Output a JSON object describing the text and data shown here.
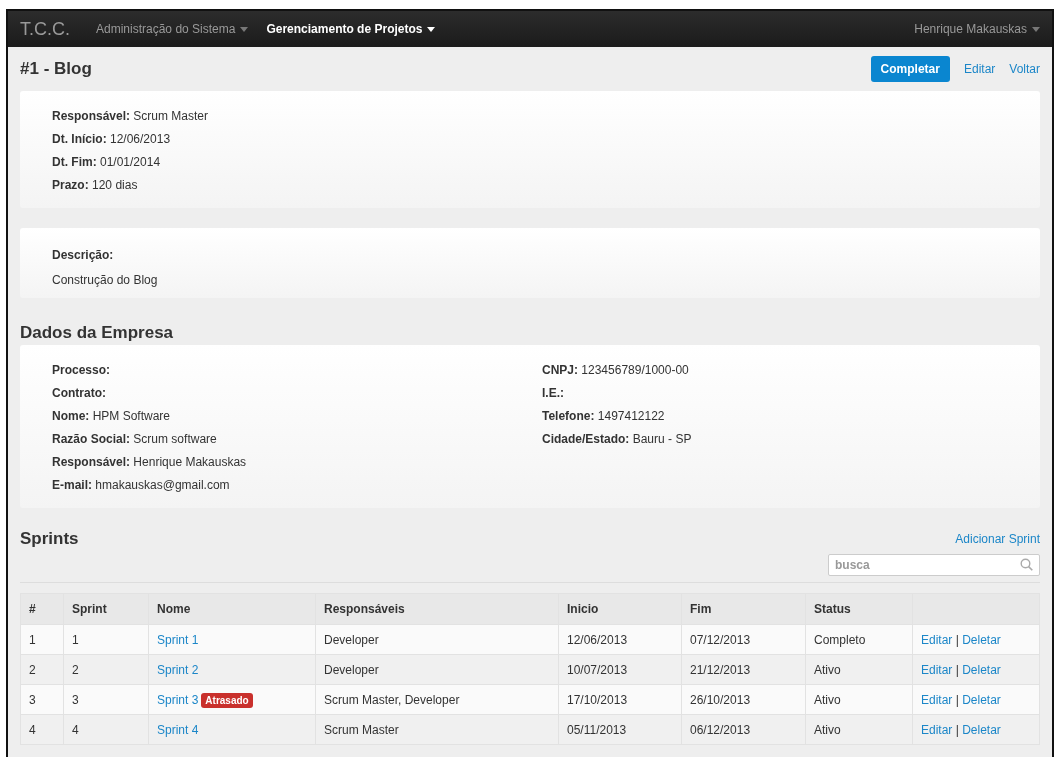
{
  "navbar": {
    "brand": "T.C.C.",
    "menus": [
      {
        "label": "Administração do Sistema",
        "selected": false
      },
      {
        "label": "Gerenciamento de Projetos",
        "selected": true
      }
    ],
    "user_menu": "Henrique Makauskas"
  },
  "page_title": "#1 - Blog",
  "actions": [
    {
      "label": "Completar",
      "kind": "primary"
    },
    {
      "label": "Editar",
      "kind": "link"
    },
    {
      "label": "Voltar",
      "kind": "link"
    }
  ],
  "project_card": [
    "**Responsável:** Scrum Master",
    "**Dt. Início:** 12/06/2013",
    "**Dt. Fim:** 01/01/2014",
    "**Prazo:** 120 dias"
  ],
  "description_card": {
    "label": "Descrição:",
    "text": "Construção do Blog"
  },
  "company": {
    "heading": "Dados da Empresa",
    "column_1": [
      "**Processo:**",
      "**Contrato:**",
      "**Nome:** HPM Software",
      "**Razão Social:** Scrum software",
      "**Responsável:** Henrique Makauskas",
      "**E-mail:** hmakauskas@gmail.com"
    ],
    "column_2": [
      "**CNPJ:** 123456789/1000-00",
      "**I.E.:**",
      "**Telefone:** 1497412122",
      "**Cidade/Estado:** Bauru - SP"
    ]
  },
  "sprints": {
    "heading": "Sprints",
    "add_link": "Adicionar Sprint",
    "search": {
      "placeholder": "busca"
    },
    "table": {
      "columns": [
        "#",
        "Sprint",
        "Nome",
        "Responsáveis",
        "Inicio",
        "Fim",
        "Status"
      ],
      "rows": [
        {
          "index": "1",
          "sprint": "1",
          "name": "Sprint 1",
          "responsible": "Developer",
          "start": "12/06/2013",
          "end": "07/12/2013",
          "status": "Completo",
          "edit": "Editar",
          "separator": "|",
          "delete": "Deletar"
        },
        {
          "index": "2",
          "sprint": "2",
          "name": "Sprint 2",
          "responsible": "Developer",
          "start": "10/07/2013",
          "end": "21/12/2013",
          "status": "Ativo",
          "edit": "Editar",
          "separator": "|",
          "delete": "Deletar"
        },
        {
          "index": "3",
          "sprint": "3",
          "name": "Sprint 3",
          "badge": "Atrasado",
          "responsible": "Scrum Master, Developer",
          "start": "17/10/2013",
          "end": "26/10/2013",
          "status": "Ativo",
          "edit": "Editar",
          "separator": "|",
          "delete": "Deletar"
        },
        {
          "index": "4",
          "sprint": "4",
          "name": "Sprint 4",
          "responsible": "Scrum Master",
          "start": "05/11/2013",
          "end": "06/12/2013",
          "status": "Ativo",
          "edit": "Editar",
          "separator": "|",
          "delete": "Deletar"
        }
      ]
    }
  }
}
